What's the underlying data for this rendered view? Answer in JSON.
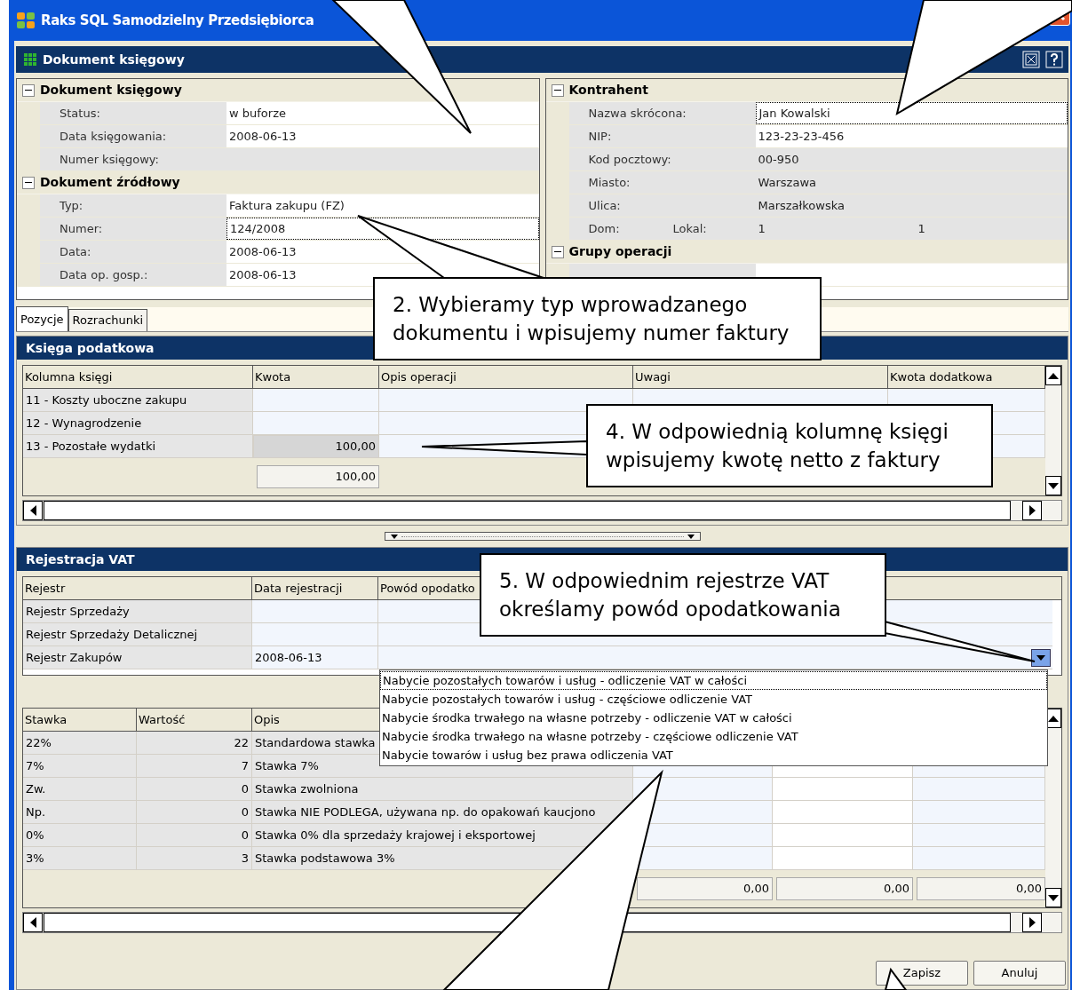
{
  "window": {
    "title": "Raks SQL Samodzielny Przedsiębiorca"
  },
  "panel": {
    "title": "Dokument księgowy"
  },
  "left_grid": {
    "sections": [
      {
        "title": "Dokument księgowy",
        "expanded": true,
        "rows": [
          {
            "label": "Status:",
            "value": "w buforze",
            "editable": true,
            "focused": false
          },
          {
            "label": "Data księgowania:",
            "value": "2008-06-13",
            "editable": true,
            "focused": false
          },
          {
            "label": "Numer księgowy:",
            "editable": false,
            "focused": false
          }
        ]
      },
      {
        "title": "Dokument źródłowy",
        "expanded": true,
        "rows": [
          {
            "label": "Typ:",
            "value": "Faktura zakupu (FZ)",
            "editable": true,
            "focused": false
          },
          {
            "label": "Numer:",
            "value": "124/2008",
            "editable": true,
            "focused": true
          },
          {
            "label": "Data:",
            "value": "2008-06-13",
            "editable": true,
            "focused": false
          },
          {
            "label": "Data op. gosp.:",
            "value": "2008-06-13",
            "editable": true,
            "focused": false
          }
        ]
      }
    ]
  },
  "right_grid": {
    "sections": [
      {
        "title": "Kontrahent",
        "expanded": true,
        "rows": [
          {
            "label": "Nazwa skrócona:",
            "value": "Jan Kowalski",
            "editable": true,
            "focused": true
          },
          {
            "label": "NIP:",
            "value": "123-23-23-456",
            "editable": true,
            "focused": false
          },
          {
            "label": "Kod pocztowy:",
            "value": "00-950",
            "editable": false,
            "focused": false
          },
          {
            "label": "Miasto:",
            "value": "Warszawa",
            "editable": false,
            "focused": false
          },
          {
            "label": "Ulica:",
            "value": "Marszałkowska",
            "editable": false,
            "focused": false
          },
          {
            "label": "Dom:",
            "label2": "Lokal:",
            "value": "1",
            "value2": "1",
            "editable": false,
            "focused": false
          }
        ]
      },
      {
        "title": "Grupy operacji",
        "expanded": true,
        "rows": [
          {
            "editable": true,
            "focused": false
          }
        ]
      }
    ]
  },
  "tabs": [
    {
      "label": "Pozycje",
      "selected": true
    },
    {
      "label": "Rozrachunki",
      "selected": false
    }
  ],
  "ledger": {
    "title": "Księga podatkowa",
    "columns": [
      "Kolumna księgi",
      "Kwota",
      "Opis operacji",
      "Uwagi",
      "Kwota dodatkowa"
    ],
    "rows": [
      {
        "name": "11 - Koszty uboczne zakupu",
        "selected": false
      },
      {
        "name": "12 - Wynagrodzenie",
        "selected": false
      },
      {
        "name": "13 - Pozostałe wydatki",
        "amount": "100,00",
        "selected": true
      }
    ],
    "total": "100,00"
  },
  "vat": {
    "title": "Rejestracja VAT",
    "columns": [
      "Rejestr",
      "Data rejestracji",
      "Powód opodatko"
    ],
    "rows": [
      {
        "name": "Rejestr Sprzedaży"
      },
      {
        "name": "Rejestr Sprzedaży Detalicznej"
      },
      {
        "name": "Rejestr Zakupów",
        "date": "2008-06-13"
      }
    ],
    "dropdown": {
      "expanded": true,
      "options": [
        {
          "label": "Nabycie pozostałych towarów i usług - odliczenie VAT w całości",
          "selected": true
        },
        {
          "label": "Nabycie pozostałych towarów i usług - częściowe odliczenie VAT",
          "selected": false
        },
        {
          "label": "Nabycie środka trwałego na własne potrzeby - odliczenie VAT w całości",
          "selected": false
        },
        {
          "label": "Nabycie środka trwałego na własne potrzeby - częściowe odliczenie VAT",
          "selected": false
        },
        {
          "label": "Nabycie towarów i usług bez prawa odliczenia VAT",
          "selected": false
        }
      ]
    }
  },
  "rates": {
    "columns": [
      "Stawka",
      "Wartość",
      "Opis"
    ],
    "rows": [
      {
        "rate": "22%",
        "value": "22",
        "description": "Standardowa stawka"
      },
      {
        "rate": "7%",
        "value": "7",
        "description": "Stawka 7%"
      },
      {
        "rate": "Zw.",
        "value": "0",
        "description": "Stawka zwolniona"
      },
      {
        "rate": "Np.",
        "value": "0",
        "description": "Stawka NIE PODLEGA, używana np. do opakowań kaucjono"
      },
      {
        "rate": "0%",
        "value": "0",
        "description": "Stawka 0% dla sprzedaży krajowej i eksportowej"
      },
      {
        "rate": "3%",
        "value": "3",
        "description": "Stawka podstawowa 3%"
      }
    ],
    "totals": [
      "0,00",
      "0,00",
      "0,00"
    ]
  },
  "buttons": [
    "Zapisz",
    "Anuluj"
  ],
  "callouts": [
    {
      "text": "2. Wybieramy typ wprowadzanego dokumentu i wpisujemy numer faktury"
    },
    {
      "text": "4. W odpowiednią kolumnę księgi wpisujemy kwotę netto z faktury"
    },
    {
      "text": "5. W odpowiednim rejestrze VAT określamy powód opodatkowania"
    }
  ]
}
